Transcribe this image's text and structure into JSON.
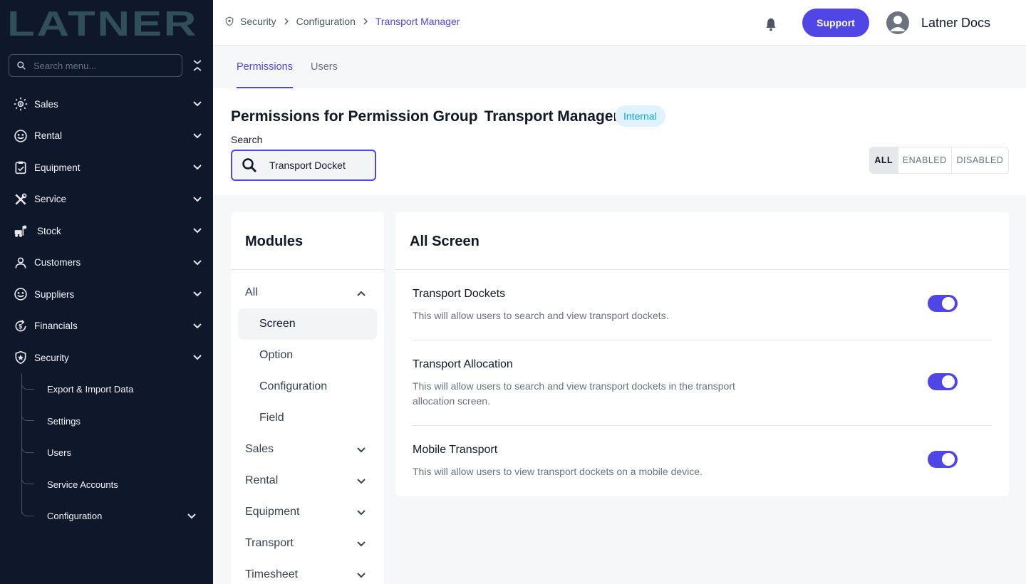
{
  "brand": {
    "logo_text": "LATNER",
    "color": "#2f4f5b"
  },
  "sidebar": {
    "search_placeholder": "Search menu...",
    "items": [
      {
        "label": "Sales",
        "icon": "sun-gear-icon"
      },
      {
        "label": "Rental",
        "icon": "smiley-badge-icon"
      },
      {
        "label": "Equipment",
        "icon": "clipboard-check-icon"
      },
      {
        "label": "Service",
        "icon": "wrench-screwdriver-icon"
      },
      {
        "label": "Stock",
        "icon": "forklift-icon"
      },
      {
        "label": "Customers",
        "icon": "person-icon"
      },
      {
        "label": "Suppliers",
        "icon": "smiley-badge-icon"
      },
      {
        "label": "Financials",
        "icon": "currency-cycle-icon"
      },
      {
        "label": "Security",
        "icon": "shield-star-icon"
      }
    ],
    "security_sub": [
      {
        "label": "Export & Import Data"
      },
      {
        "label": "Settings"
      },
      {
        "label": "Users"
      },
      {
        "label": "Service Accounts"
      },
      {
        "label": "Configuration"
      }
    ]
  },
  "topbar": {
    "breadcrumb": [
      "Security",
      "Configuration",
      "Transport Manager"
    ],
    "support_label": "Support",
    "user_name": "Latner Docs"
  },
  "tabs": [
    {
      "label": "Permissions"
    },
    {
      "label": "Users"
    }
  ],
  "header": {
    "title_prefix": "Permissions for Permission Group",
    "title_group": "Transport Manager",
    "badge": "Internal",
    "search_label": "Search",
    "search_value": "Transport Docket",
    "filters": [
      {
        "label": "ALL"
      },
      {
        "label": "ENABLED"
      },
      {
        "label": "DISABLED"
      }
    ],
    "active_filter": "ALL"
  },
  "modules": {
    "title": "Modules",
    "all_label": "All",
    "sub_items": [
      {
        "label": "Screen"
      },
      {
        "label": "Option"
      },
      {
        "label": "Configuration"
      },
      {
        "label": "Field"
      }
    ],
    "active_sub": "Screen",
    "groups": [
      {
        "label": "Sales"
      },
      {
        "label": "Rental"
      },
      {
        "label": "Equipment"
      },
      {
        "label": "Transport"
      },
      {
        "label": "Timesheet"
      }
    ]
  },
  "permissions": {
    "title": "All Screen",
    "items": [
      {
        "name": "Transport Dockets",
        "description": "This will allow users to search and view transport dockets.",
        "enabled": true
      },
      {
        "name": "Transport Allocation",
        "description": "This will allow users to search and view transport dockets in the transport allocation screen.",
        "enabled": true
      },
      {
        "name": "Mobile Transport",
        "description": "This will allow users to view transport dockets on a mobile device.",
        "enabled": true
      }
    ]
  },
  "colors": {
    "accent": "#4f46e5",
    "sidebar_bg": "#0f172a",
    "badge_bg": "#e0f2fe",
    "badge_text": "#0ea5e9"
  }
}
